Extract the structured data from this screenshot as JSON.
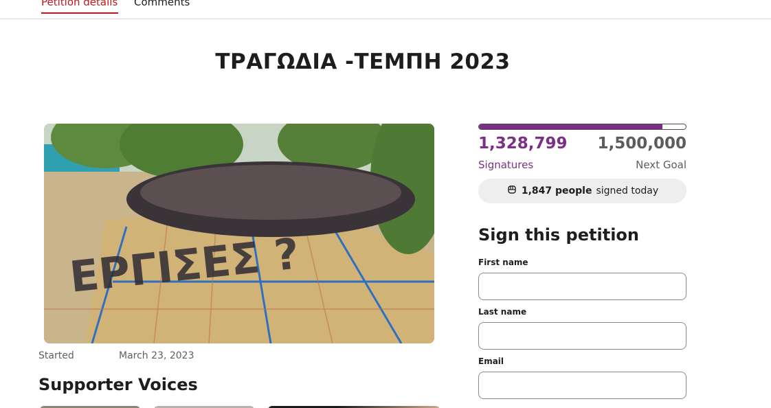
{
  "tabs": [
    {
      "label": "Petition details",
      "active": true
    },
    {
      "label": "Comments",
      "active": false
    }
  ],
  "petition": {
    "title": "ΤΡΑΓΩΔΙΑ -ΤΕΜΠΗ 2023",
    "hero_image_icon": "crowd-photo",
    "hero_image_text": "ΕΡΓΙΣΕΣ ?",
    "started_label": "Started",
    "started_date": "March 23, 2023"
  },
  "supporters": {
    "heading": "Supporter Voices"
  },
  "progress": {
    "signatures": "1,328,799",
    "signatures_label": "Signatures",
    "goal": "1,500,000",
    "goal_label": "Next Goal",
    "fill_fraction": 0.886,
    "accent_color": "#7c2f87"
  },
  "today": {
    "icon": "raised-fist-icon",
    "count_text": "1,847 people",
    "suffix": "signed today"
  },
  "form": {
    "heading": "Sign this petition",
    "first_name_label": "First name",
    "first_name_value": "",
    "last_name_label": "Last name",
    "last_name_value": "",
    "email_label": "Email",
    "email_value": ""
  }
}
